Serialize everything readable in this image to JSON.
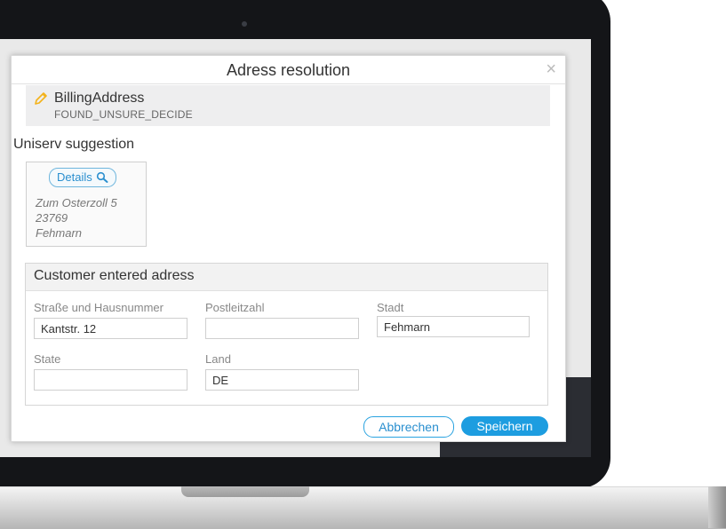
{
  "dialog": {
    "title": "Adress resolution",
    "close_icon": "close-icon",
    "close_glyph": "×"
  },
  "billing": {
    "title": "BillingAddress",
    "status": "FOUND_UNSURE_DECIDE",
    "icon": "pencil-icon"
  },
  "suggestion": {
    "heading": "Uniserv suggestion",
    "details_label": "Details",
    "details_icon": "magnifier-icon",
    "address_lines": [
      "Zum Osterzoll 5",
      "23769",
      "Fehmarn"
    ]
  },
  "customer": {
    "heading": "Customer entered adress",
    "fields": {
      "street": {
        "label": "Straße und Hausnummer",
        "value": "Kantstr. 12"
      },
      "postcode": {
        "label": "Postleitzahl",
        "value": ""
      },
      "city": {
        "label": "Stadt",
        "value": "Fehmarn"
      },
      "state": {
        "label": "State",
        "value": ""
      },
      "country": {
        "label": "Land",
        "value": "DE"
      }
    }
  },
  "actions": {
    "cancel_label": "Abbrechen",
    "save_label": "Speichern"
  },
  "colors": {
    "accent": "#1d9de0",
    "pencil": "#f3b21a"
  }
}
